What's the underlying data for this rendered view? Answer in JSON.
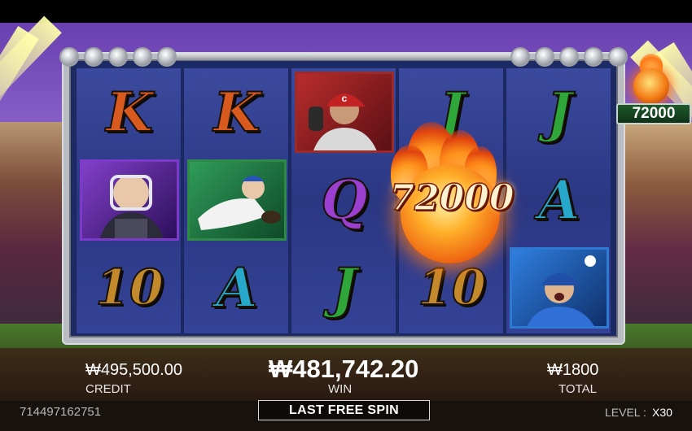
{
  "jackpot": {
    "value": "72000"
  },
  "reels": [
    {
      "symbols": [
        "K",
        "purple-catcher-portrait",
        "10"
      ]
    },
    {
      "symbols": [
        "K",
        "green-sliding-player-portrait",
        "A"
      ]
    },
    {
      "symbols": [
        "red-batter-portrait",
        "Q",
        "J"
      ]
    },
    {
      "symbols": [
        "J",
        "fireball-72000",
        "10"
      ]
    },
    {
      "symbols": [
        "J",
        "A",
        "blue-pitcher-portrait"
      ]
    }
  ],
  "symbol_text": {
    "k1": "K",
    "k2": "K",
    "q": "Q",
    "j3": "J",
    "j4": "J",
    "j5": "J",
    "a2": "A",
    "a5": "A",
    "ten1": "10",
    "ten4": "10"
  },
  "fireball": {
    "value": "72000"
  },
  "status": {
    "credit_value": "₩495,500.00",
    "credit_label": "CREDIT",
    "win_value": "₩481,742.20",
    "win_label": "WIN",
    "total_value": "₩1800",
    "total_label": "TOTAL"
  },
  "footer": {
    "session_id": "714497162751",
    "spin_button": "LAST FREE SPIN",
    "level_label": "LEVEL :",
    "level_value": "X30"
  },
  "colors": {
    "k": "#d85a1e",
    "q": "#9b3fd1",
    "j": "#2ea63a",
    "a": "#27a7c9",
    "ten": "#c28a2c",
    "reel_bg": "#2a3783",
    "frame": "#b9bcc2",
    "jackpot_plate": "#1e5a2a"
  }
}
